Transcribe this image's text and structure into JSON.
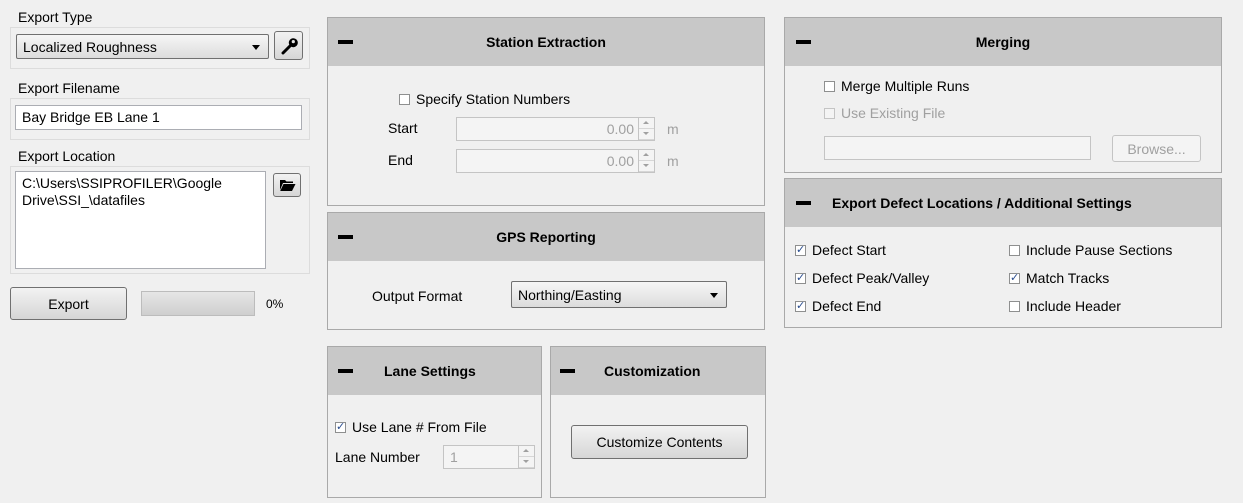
{
  "export_type": {
    "label": "Export Type",
    "selected": "Localized Roughness",
    "settings_icon": "wrench-icon"
  },
  "export_filename": {
    "label": "Export Filename",
    "value": "Bay Bridge EB Lane 1"
  },
  "export_location": {
    "label": "Export Location",
    "value": "C:\\Users\\SSIPROFILER\\Google Drive\\SSI_\\datafiles",
    "browse_icon": "folder-open-icon"
  },
  "export": {
    "button_label": "Export",
    "progress_percent": 0,
    "progress_text": "0%"
  },
  "station_extraction": {
    "title": "Station Extraction",
    "specify_label": "Specify Station Numbers",
    "specify_checked": false,
    "start_label": "Start",
    "start_value": "0.00",
    "start_unit": "m",
    "end_label": "End",
    "end_value": "0.00",
    "end_unit": "m"
  },
  "gps_reporting": {
    "title": "GPS Reporting",
    "output_label": "Output Format",
    "output_selected": "Northing/Easting"
  },
  "lane_settings": {
    "title": "Lane Settings",
    "use_lane_label": "Use Lane # From File",
    "use_lane_checked": true,
    "lane_number_label": "Lane Number",
    "lane_number_value": "1"
  },
  "customization": {
    "title": "Customization",
    "button_label": "Customize Contents"
  },
  "merging": {
    "title": "Merging",
    "merge_label": "Merge Multiple Runs",
    "merge_checked": false,
    "existing_label": "Use Existing File",
    "existing_checked": false,
    "file_path": "",
    "browse_label": "Browse..."
  },
  "defect_locations": {
    "title": "Export Defect Locations / Additional Settings",
    "options": [
      {
        "label": "Defect Start",
        "checked": true
      },
      {
        "label": "Defect Peak/Valley",
        "checked": true
      },
      {
        "label": "Defect End",
        "checked": true
      },
      {
        "label": "Include Pause Sections",
        "checked": false
      },
      {
        "label": "Match Tracks",
        "checked": true
      },
      {
        "label": "Include Header",
        "checked": false
      }
    ]
  }
}
